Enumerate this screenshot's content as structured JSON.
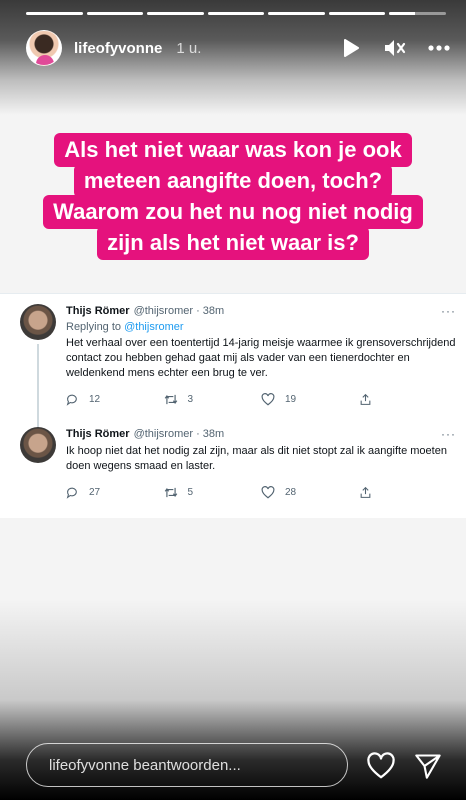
{
  "story": {
    "progress": [
      1,
      1,
      1,
      1,
      1,
      1,
      0.45
    ],
    "username": "lifeofyvonne",
    "time": "1 u.",
    "caption_lines": [
      "Als het niet waar was kon je ook",
      "meteen aangifte doen, toch?",
      "Waarom zou het nu nog niet nodig",
      "zijn als het niet waar is?"
    ],
    "caption_color": "#e5127d"
  },
  "tweets": [
    {
      "name": "Thijs Römer",
      "handle": "@thijsromer · 38m",
      "replying_prefix": "Replying to ",
      "replying_handle": "@thijsromer",
      "text": "Het verhaal over een toentertijd 14-jarig meisje waarmee ik grensoverschrijdend contact zou hebben gehad gaat mij als vader van een tienerdochter en weldenkend mens echter een brug te ver.",
      "replies": "12",
      "retweets": "3",
      "likes": "19"
    },
    {
      "name": "Thijs Römer",
      "handle": "@thijsromer · 38m",
      "text": "Ik hoop niet dat het nodig zal zijn, maar als dit niet stopt zal ik aangifte moeten doen wegens smaad en laster.",
      "replies": "27",
      "retweets": "5",
      "likes": "28"
    }
  ],
  "reply_box": {
    "placeholder": "lifeofyvonne beantwoorden..."
  },
  "icons": {
    "play": "play-icon",
    "mute": "mute-icon",
    "more": "more-icon",
    "reply": "reply-icon",
    "retweet": "retweet-icon",
    "like": "heart-icon",
    "share": "share-icon",
    "send": "send-icon"
  }
}
